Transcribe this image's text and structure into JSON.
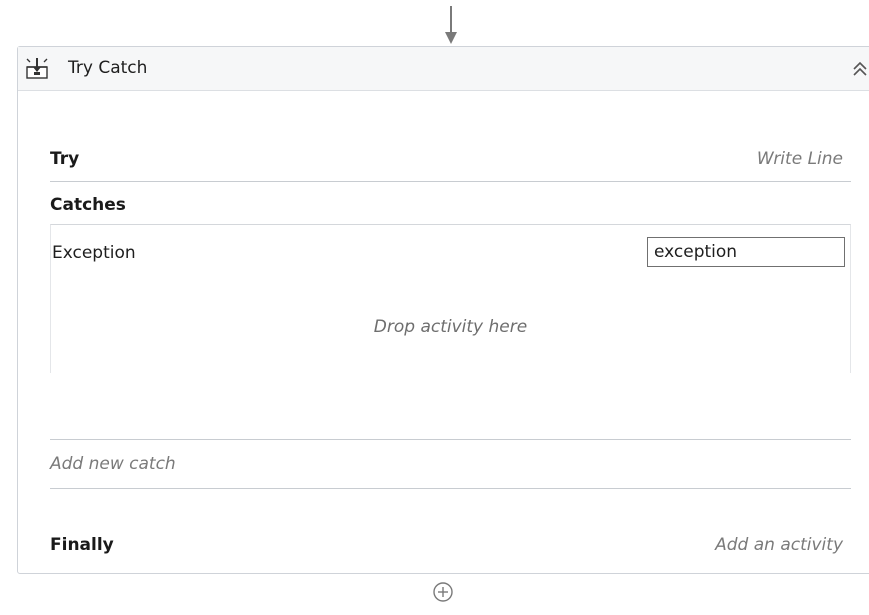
{
  "activity": {
    "title": "Try Catch",
    "header_icon": "try-catch-activity-icon",
    "collapse_icon": "double-chevron-up-icon"
  },
  "try_section": {
    "label": "Try",
    "activity": "Write Line"
  },
  "catches_section": {
    "label": "Catches",
    "catches": [
      {
        "exception_type": "Exception",
        "variable_name": "exception",
        "body_placeholder": "Drop activity here"
      }
    ],
    "add_catch_label": "Add new catch"
  },
  "finally_section": {
    "label": "Finally",
    "placeholder": "Add an activity"
  },
  "icons": {
    "incoming": "arrow-down-icon",
    "add": "plus-circle-icon"
  }
}
